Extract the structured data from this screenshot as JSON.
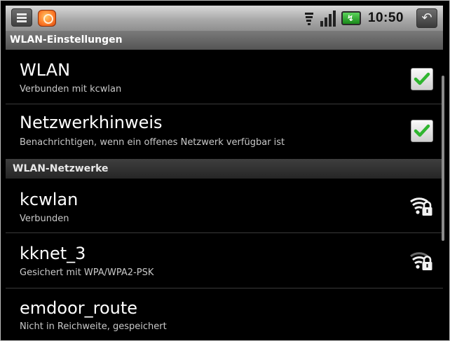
{
  "status_bar": {
    "time": "10:50",
    "icons": [
      "menu-icon",
      "app-icon",
      "wifi-signal-icon",
      "cell-signal-icon",
      "battery-charging-icon",
      "back-icon"
    ]
  },
  "title_bar": {
    "title": "WLAN-Einstellungen"
  },
  "settings": [
    {
      "title": "WLAN",
      "summary": "Verbunden mit kcwlan",
      "checked": true
    },
    {
      "title": "Netzwerkhinweis",
      "summary": "Benachrichtigen, wenn ein offenes Netzwerk verfügbar ist",
      "checked": true
    }
  ],
  "networks_header": "WLAN-Netzwerke",
  "networks": [
    {
      "name": "kcwlan",
      "status": "Verbunden",
      "signal": "strong",
      "secured": true
    },
    {
      "name": "kknet_3",
      "status": "Gesichert mit WPA/WPA2-PSK",
      "signal": "medium",
      "secured": true
    },
    {
      "name": "emdoor_route",
      "status": "Nicht in Reichweite, gespeichert"
    }
  ],
  "colors": {
    "check_green": "#2fb52f",
    "background": "#000000",
    "header": "#2e2e2e"
  }
}
